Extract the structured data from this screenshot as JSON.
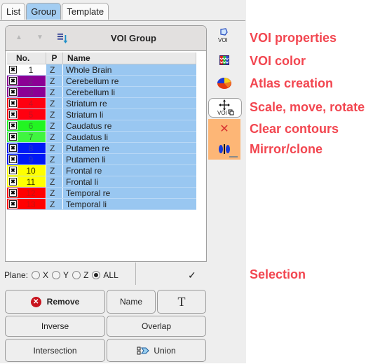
{
  "tabs": [
    {
      "label": "List",
      "active": false
    },
    {
      "label": "Group",
      "active": true
    },
    {
      "label": "Template",
      "active": false
    }
  ],
  "group": {
    "title": "VOI Group",
    "icons": {
      "move_up": "triangle-up-icon",
      "move_down": "triangle-down-icon",
      "sort": "sort-list-icon"
    }
  },
  "table": {
    "columns": [
      "No.",
      "P",
      "Name"
    ],
    "rows": [
      {
        "no": "1",
        "p": "Z",
        "name": "Whole Brain",
        "color": "#ffffff",
        "text_color": "#222222",
        "checked": true
      },
      {
        "no": "2",
        "p": "Z",
        "name": "Cerebellum re",
        "color": "#8b0095",
        "text_color": "#6a2a78",
        "checked": true
      },
      {
        "no": "3",
        "p": "Z",
        "name": "Cerebellum li",
        "color": "#8b0095",
        "text_color": "#6a2a78",
        "checked": true
      },
      {
        "no": "4",
        "p": "Z",
        "name": "Striatum re",
        "color": "#ff0010",
        "text_color": "#c81020",
        "checked": true
      },
      {
        "no": "5",
        "p": "Z",
        "name": "Striatum li",
        "color": "#ff0010",
        "text_color": "#c81020",
        "checked": true
      },
      {
        "no": "6",
        "p": "Z",
        "name": "Caudatus re",
        "color": "#22f522",
        "text_color": "#2c9a2c",
        "checked": true
      },
      {
        "no": "7",
        "p": "Z",
        "name": "Caudatus li",
        "color": "#40f540",
        "text_color": "#2c7a2c",
        "checked": true
      },
      {
        "no": "8",
        "p": "Z",
        "name": "Putamen re",
        "color": "#0019f5",
        "text_color": "#2a3ab8",
        "checked": true
      },
      {
        "no": "9",
        "p": "Z",
        "name": "Putamen li",
        "color": "#0019f5",
        "text_color": "#2a3ab8",
        "checked": true
      },
      {
        "no": "10",
        "p": "Z",
        "name": "Frontal re",
        "color": "#ffff00",
        "text_color": "#333300",
        "checked": true
      },
      {
        "no": "11",
        "p": "Z",
        "name": "Frontal li",
        "color": "#ffff00",
        "text_color": "#333300",
        "checked": true
      },
      {
        "no": "12",
        "p": "Z",
        "name": "Temporal re",
        "color": "#ff0000",
        "text_color": "#c81010",
        "checked": true
      },
      {
        "no": "13",
        "p": "Z",
        "name": "Temporal li",
        "color": "#ff0000",
        "text_color": "#c81010",
        "checked": true
      }
    ]
  },
  "side_toolbar": [
    {
      "name": "voi-properties",
      "icon": "voi-properties-icon"
    },
    {
      "name": "voi-color",
      "icon": "voi-color-icon"
    },
    {
      "name": "atlas-creation",
      "icon": "atlas-brain-icon"
    },
    {
      "name": "scale-move-rotate",
      "icon": "move-voi-icon"
    },
    {
      "name": "clear-contours",
      "icon": "clear-x-icon"
    },
    {
      "name": "mirror-clone",
      "icon": "mirror-icon"
    }
  ],
  "plane": {
    "label": "Plane:",
    "options": [
      {
        "label": "X",
        "selected": false
      },
      {
        "label": "Y",
        "selected": false
      },
      {
        "label": "Z",
        "selected": false
      },
      {
        "label": "ALL",
        "selected": true
      }
    ],
    "check_symbol": "✓"
  },
  "buttons": {
    "remove": "Remove",
    "name": "Name",
    "text": "T",
    "inverse": "Inverse",
    "overlap": "Overlap",
    "intersection": "Intersection",
    "union": "Union"
  },
  "annotations": {
    "voi_properties": "VOI properties",
    "voi_color": "VOI color",
    "atlas_creation": "Atlas creation",
    "scale_move_rotate": "Scale, move, rotate",
    "clear_contours": "Clear contours",
    "mirror_clone": "Mirror/clone",
    "selection": "Selection"
  },
  "colors": {
    "accent_annotation": "#f24650",
    "selected_row": "#99c7f1",
    "active_tab": "#a3cdf2",
    "orange_tool": "#fdb676"
  }
}
